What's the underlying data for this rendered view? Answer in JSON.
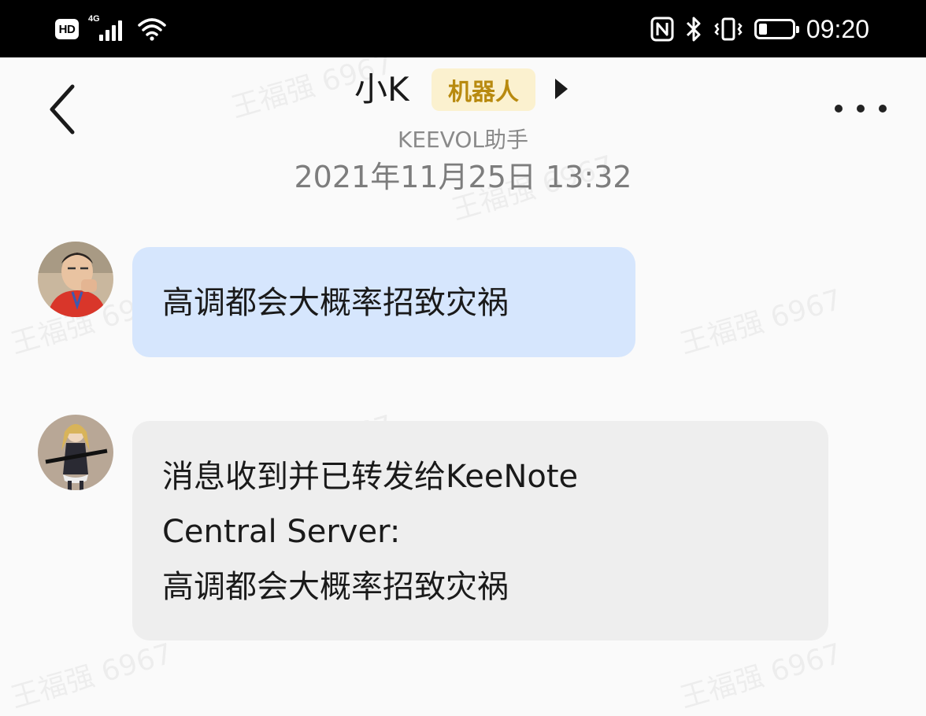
{
  "status_bar": {
    "hd_label": "HD",
    "network_label": "4G",
    "clock": "09:20",
    "battery_level": 0.25,
    "icons": [
      "signal-icon",
      "wifi-icon",
      "nfc-icon",
      "bluetooth-icon",
      "vibrate-icon",
      "battery-icon"
    ]
  },
  "header": {
    "title": "小K",
    "badge": "机器人",
    "subtitle": "KEEVOL助手",
    "datetime": "2021年11月25日 13:32"
  },
  "watermark": "王福强 6967",
  "messages": [
    {
      "direction": "outgoing",
      "text": "高调都会大概率招致灾祸"
    },
    {
      "direction": "incoming",
      "lines": [
        "消息收到并已转发给KeeNote",
        "Central Server:",
        "高调都会大概率招致灾祸"
      ]
    }
  ],
  "colors": {
    "outgoing_bubble": "#d6e6fd",
    "incoming_bubble": "#eeeeee",
    "badge_bg": "#fbf1cf",
    "badge_text": "#b88a0f"
  }
}
